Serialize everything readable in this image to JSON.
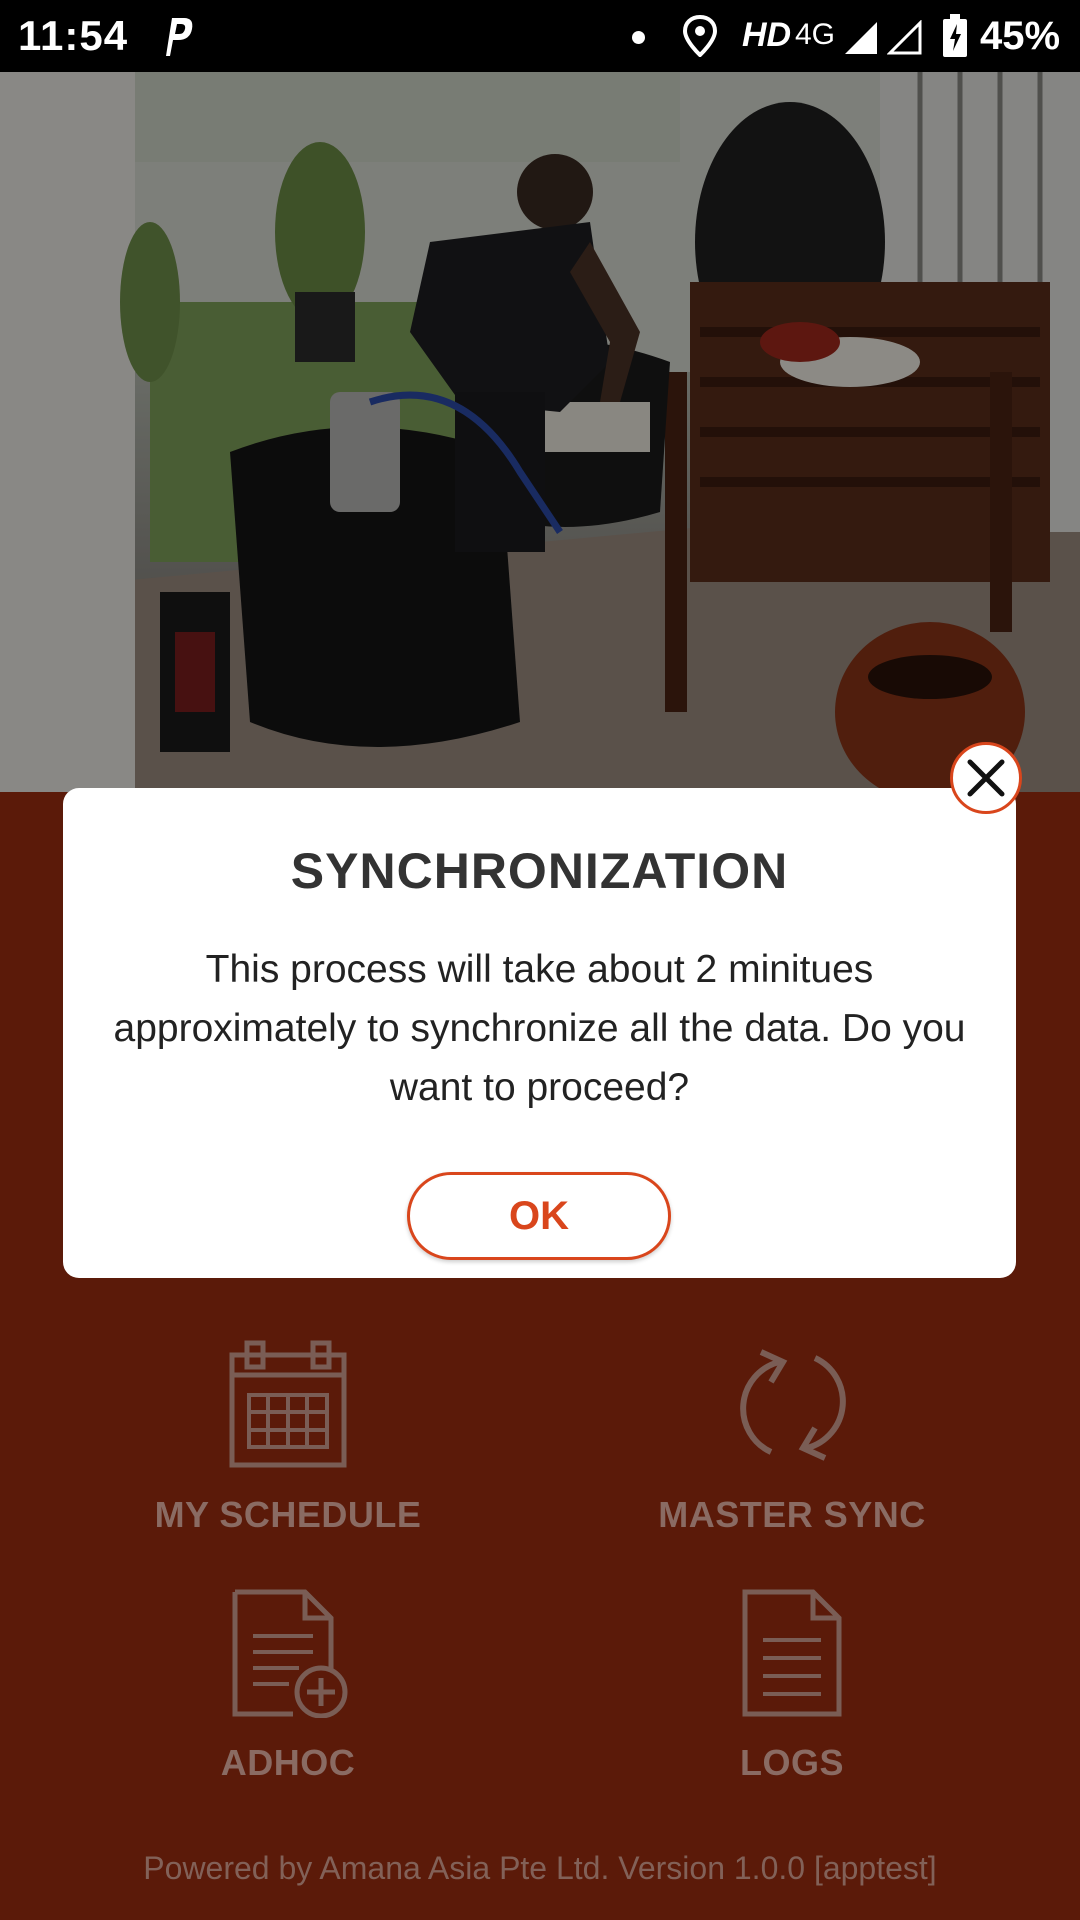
{
  "status_bar": {
    "time": "11:54",
    "hd_label": "HD",
    "network_label": "4G",
    "battery_percent": "45%",
    "icons": [
      "parking-app-icon",
      "notification-dot-icon",
      "location-icon",
      "signal-icon",
      "signal-empty-icon",
      "battery-icon"
    ]
  },
  "dialog": {
    "title": "SYNCHRONIZATION",
    "message": "This process will take about 2 minitues approximately to synchronize all the data. Do you want to proceed?",
    "ok_label": "OK",
    "close_icon": "close-icon"
  },
  "menu": {
    "items": [
      {
        "label": "MY SCHEDULE",
        "icon": "calendar-icon"
      },
      {
        "label": "MASTER SYNC",
        "icon": "sync-icon"
      },
      {
        "label": "ADHOC",
        "icon": "document-add-icon"
      },
      {
        "label": "LOGS",
        "icon": "document-icon"
      }
    ]
  },
  "footer": {
    "text": "Powered by Amana Asia Pte Ltd. Version 1.0.0  [apptest]"
  },
  "colors": {
    "accent": "#d9461c",
    "background": "#5b1a09",
    "status_bar": "#000000"
  }
}
